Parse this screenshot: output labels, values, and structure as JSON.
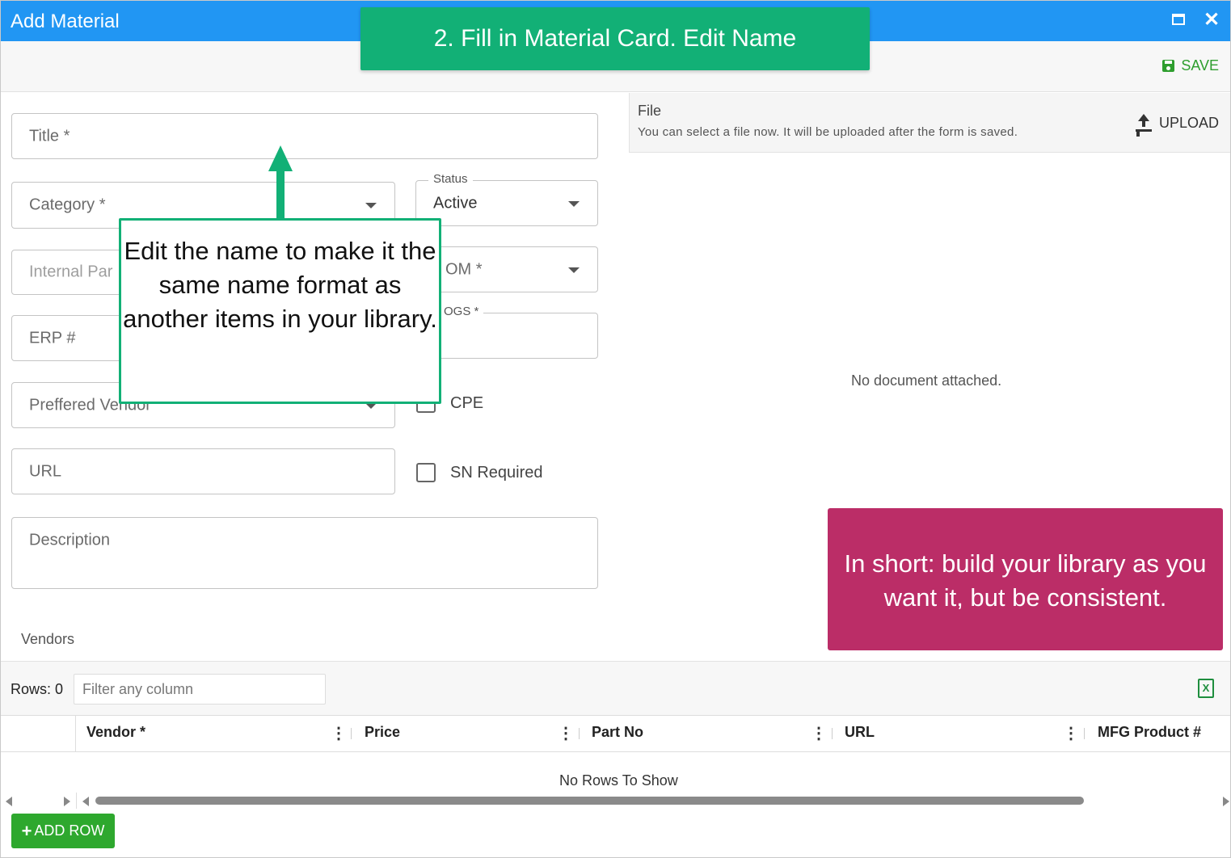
{
  "window": {
    "title": "Add Material"
  },
  "toolbar": {
    "save_label": "SAVE"
  },
  "form": {
    "title_placeholder": "Title *",
    "category_placeholder": "Category *",
    "status_legend": "Status",
    "status_value": "Active",
    "internal_part_placeholder": "Internal Par",
    "uom_placeholder": "OM *",
    "cogs_legend": "OGS *",
    "erp_placeholder": "ERP #",
    "vendor_placeholder": "Preffered Vendor",
    "cpe_label": "CPE",
    "url_placeholder": "URL",
    "sn_label": "SN Required",
    "description_placeholder": "Description"
  },
  "file": {
    "title": "File",
    "hint": "You can select a file now. It will be uploaded after the form is saved.",
    "upload_label": "UPLOAD",
    "empty": "No document attached."
  },
  "vendors": {
    "label": "Vendors",
    "rows_label": "Rows: 0",
    "filter_placeholder": "Filter any column",
    "excel_glyph": "X",
    "columns": [
      "Vendor *",
      "Price",
      "Part No",
      "URL",
      "MFG Product #"
    ],
    "empty": "No Rows To Show",
    "add_row_label": "ADD ROW"
  },
  "overlays": {
    "banner": "2. Fill in Material Card. Edit Name",
    "callout": "Edit the name to make it the same name format as another items in your library.",
    "tip": "In short: build your library as you want it, but be consistent."
  },
  "colors": {
    "titlebar": "#2196f3",
    "save": "#2e9e2e",
    "banner": "#12b076",
    "tip": "#bb2d67",
    "add_row": "#2ea82e"
  }
}
